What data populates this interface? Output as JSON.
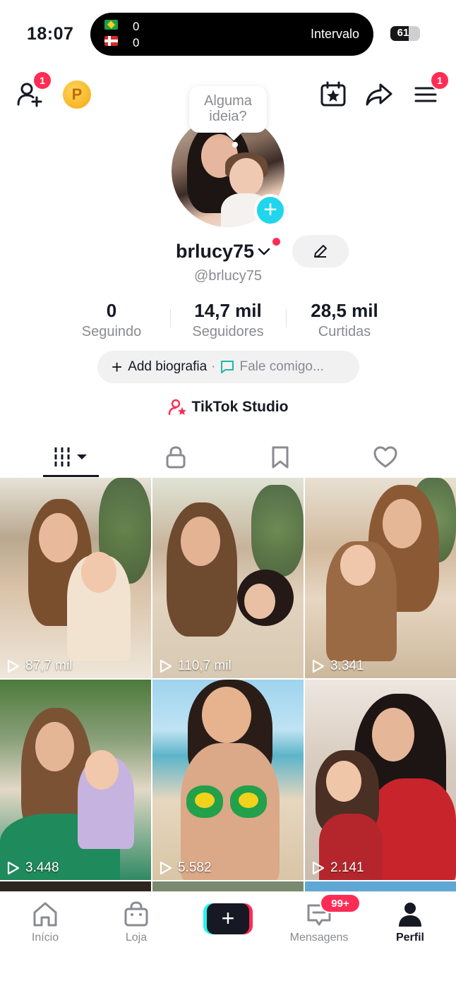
{
  "status_bar": {
    "time": "18:07",
    "match": {
      "score_home": "0",
      "score_away": "0",
      "status": "Intervalo"
    },
    "battery": "61",
    "battery_level": 0.61
  },
  "top_bar": {
    "add_friends_badge": "1",
    "menu_badge": "1"
  },
  "profile": {
    "tooltip": "Alguma ideia?",
    "username": "brlucy75",
    "handle": "@brlucy75",
    "stats": [
      {
        "value": "0",
        "label": "Seguindo"
      },
      {
        "value": "14,7 mil",
        "label": "Seguidores"
      },
      {
        "value": "28,5 mil",
        "label": "Curtidas"
      }
    ],
    "bio_add": "Add biografia",
    "bio_separator": "·",
    "bio_talk": "Fale comigo...",
    "studio": "TikTok Studio"
  },
  "grid": {
    "videos": [
      {
        "views": "87,7 mil"
      },
      {
        "views": "110,7 mil"
      },
      {
        "views": "3.341"
      },
      {
        "views": "3.448"
      },
      {
        "views": "5.582"
      },
      {
        "views": "2.141"
      }
    ]
  },
  "bottom_nav": {
    "items": [
      {
        "label": "Início"
      },
      {
        "label": "Loja"
      },
      {
        "label": "Mensagens",
        "badge": "99+"
      },
      {
        "label": "Perfil"
      }
    ]
  },
  "colors": {
    "brand_red": "#fe2c55",
    "brand_cyan": "#25f4ee",
    "add_blue": "#20d5ec",
    "text": "#161823",
    "muted": "#8a8b91"
  }
}
